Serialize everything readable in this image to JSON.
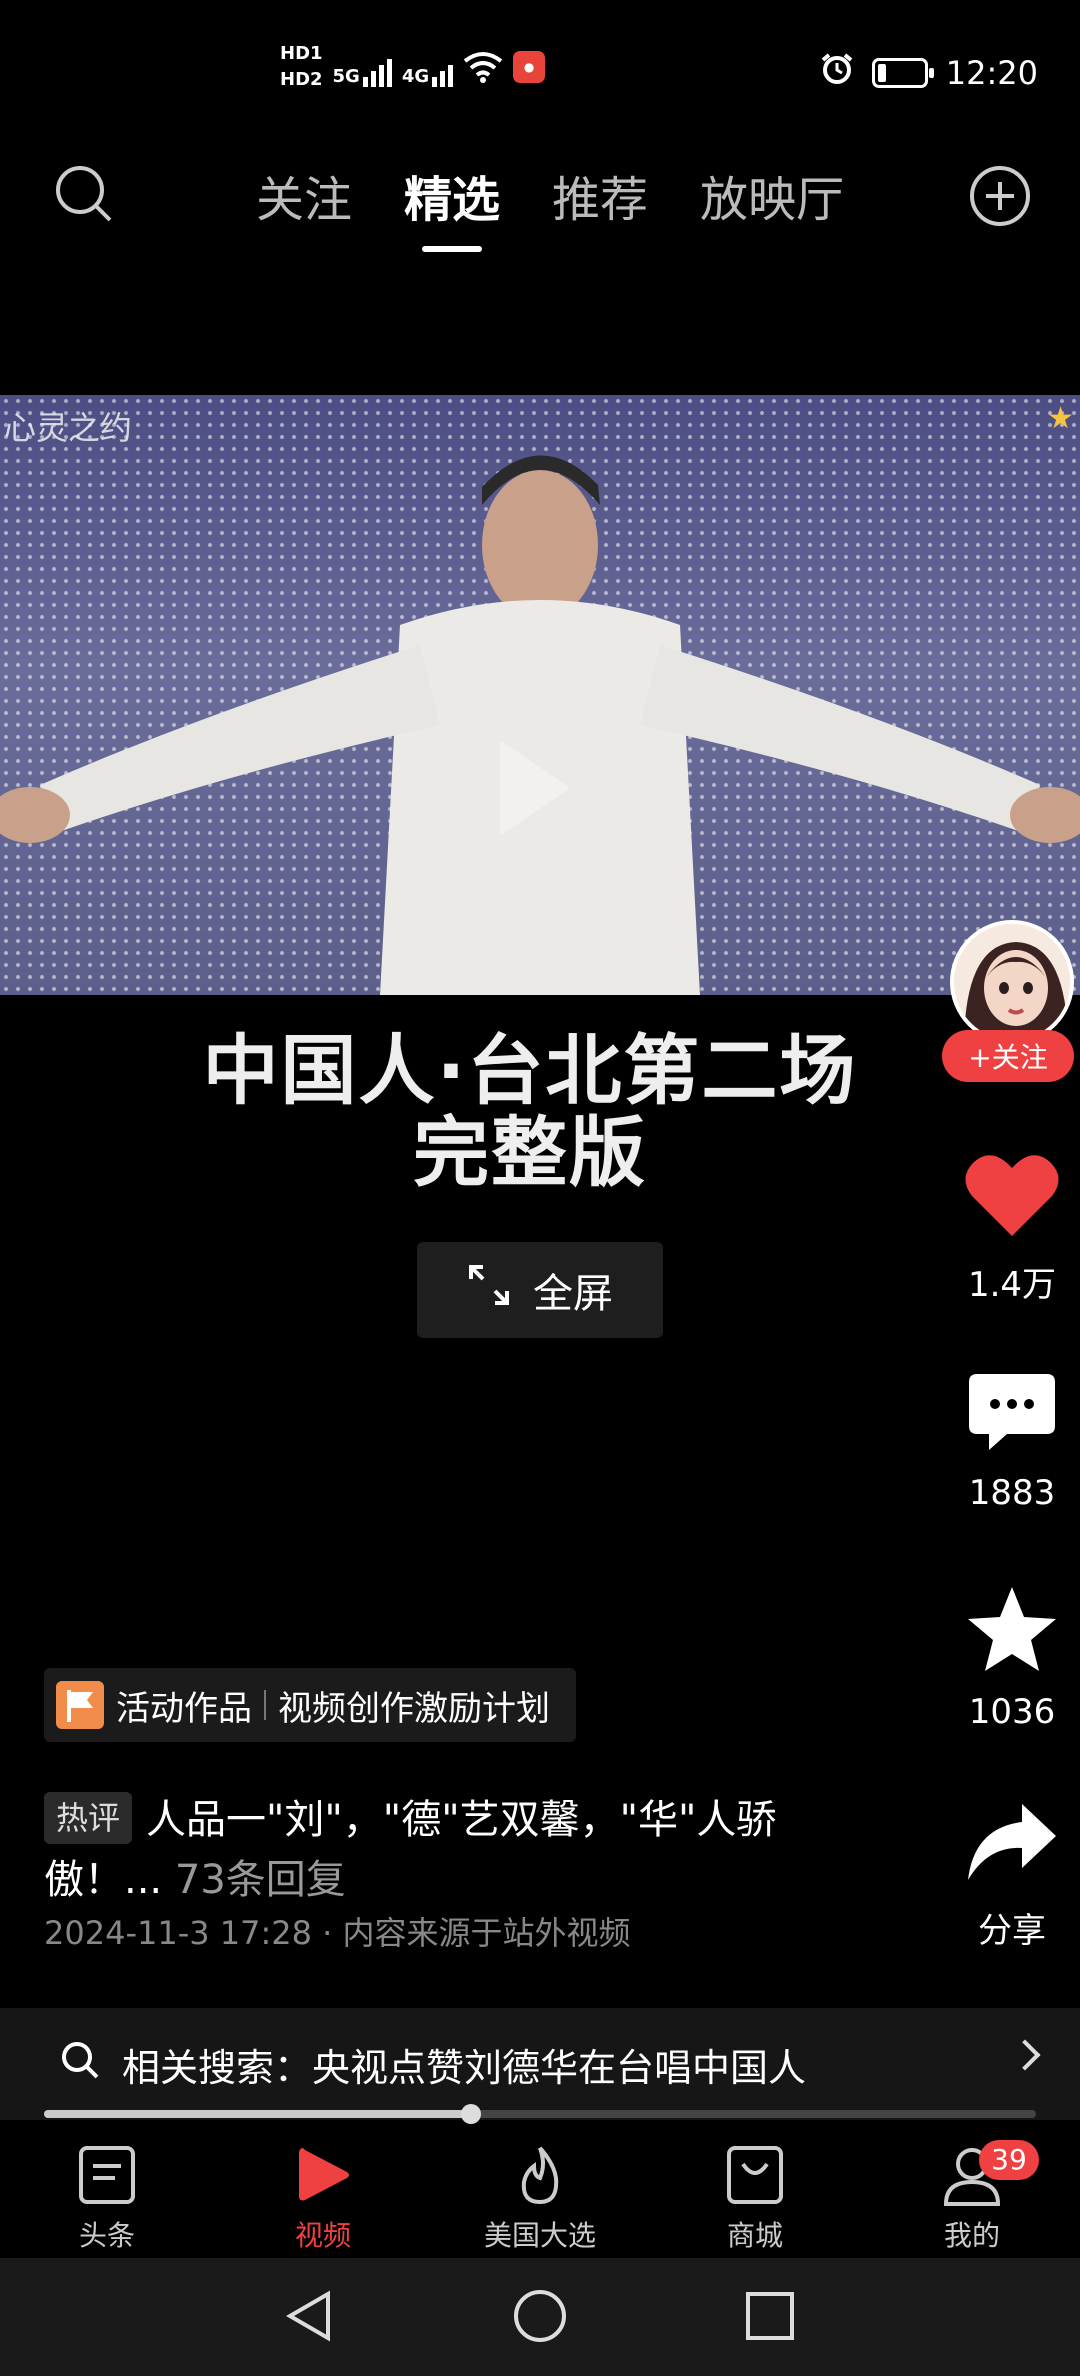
{
  "status_bar": {
    "hd1": "HD1",
    "hd2": "HD2",
    "net1": "5G",
    "net2": "4G",
    "time": "12:20"
  },
  "top_nav": {
    "tabs": [
      "关注",
      "精选",
      "推荐",
      "放映厅"
    ],
    "active_tab_index": 1
  },
  "video": {
    "watermark": "心灵之约",
    "title_line1": "中国人·台北第二场",
    "title_line2": "完整版",
    "fullscreen_label": "全屏"
  },
  "rail": {
    "follow_label": "+关注",
    "likes": "1.4万",
    "comments": "1883",
    "favorites": "1036",
    "share_label": "分享"
  },
  "activity": {
    "label": "活动作品",
    "plan": "视频创作激励计划"
  },
  "comment": {
    "tag": "热评",
    "text": "人品一\"刘\"，\"德\"艺双馨，\"华\"人骄傲！...",
    "replies": "73条回复",
    "meta": "2024-11-3 17:28 · 内容来源于站外视频"
  },
  "related_search": {
    "text": "相关搜索：央视点赞刘德华在台唱中国人"
  },
  "progress": {
    "fraction": 0.43
  },
  "tab_bar": {
    "items": [
      "头条",
      "视频",
      "美国大选",
      "商城",
      "我的"
    ],
    "active_index": 1,
    "mine_badge": "39"
  },
  "colors": {
    "accent": "#f04142",
    "background": "#000000"
  }
}
